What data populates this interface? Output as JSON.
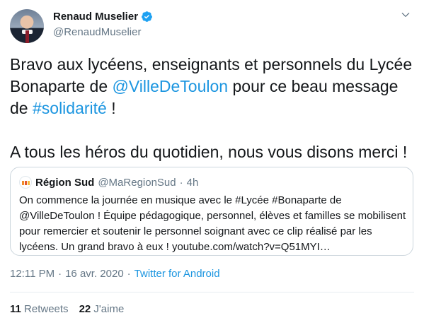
{
  "author": {
    "display_name": "Renaud Muselier",
    "handle": "@RenaudMuselier"
  },
  "tweet": {
    "line1": "Bravo aux lycéens, enseignants et personnels du Lycée",
    "line2_prefix": "Bonaparte de ",
    "mention": "@VilleDeToulon",
    "line2_suffix": " pour ce beau message",
    "line3_prefix": "de ",
    "hashtag": "#solidarité",
    "line3_suffix": " !",
    "line4": "A tous les héros du quotidien, nous vous disons merci !"
  },
  "quoted_tweet": {
    "name": "Région Sud",
    "handle": "@MaRegionSud",
    "separator": "·",
    "time": "4h",
    "lines": [
      "On commence la journée en musique avec le #Lycée #Bonaparte de",
      "@VilleDeToulon ! Équipe pédagogique, personnel, élèves et familles se mobilisent",
      "pour remercier et soutenir le personnel soignant avec ce clip réalisé par les",
      "lycéens. Un grand bravo à eux ! youtube.com/watch?v=Q51MYI…"
    ]
  },
  "meta": {
    "time": "12:11 PM",
    "separator1": "·",
    "date": "16 avr. 2020",
    "separator2": "·",
    "source": "Twitter for Android"
  },
  "stats": {
    "retweets_count": "11",
    "retweets_label": "Retweets",
    "likes_count": "22",
    "likes_label": "J'aime"
  },
  "icons": {
    "verified": "verified-badge-icon",
    "caret": "chevron-down-icon"
  },
  "colors": {
    "link": "#1b95e0",
    "secondary_text": "#657786",
    "border": "#ccd6dd"
  }
}
